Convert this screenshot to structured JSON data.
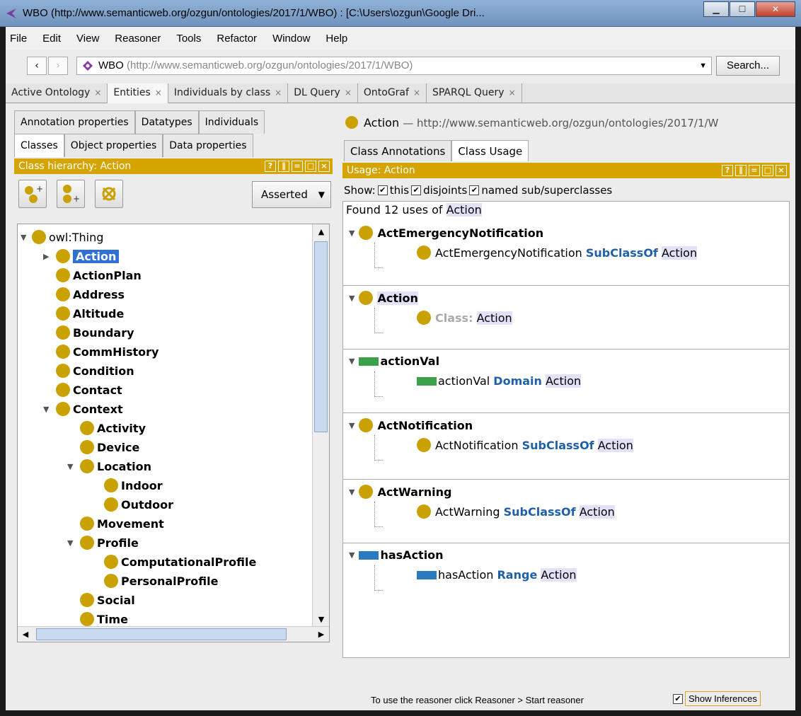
{
  "window": {
    "title": "WBO (http://www.semanticweb.org/ozgun/ontologies/2017/1/WBO)  : [C:\\Users\\ozgun\\Google Dri..."
  },
  "menu": [
    "File",
    "Edit",
    "View",
    "Reasoner",
    "Tools",
    "Refactor",
    "Window",
    "Help"
  ],
  "address": {
    "name": "WBO",
    "uri": "(http://www.semanticweb.org/ozgun/ontologies/2017/1/WBO)",
    "search_label": "Search..."
  },
  "tabs": [
    "Active Ontology",
    "Entities",
    "Individuals by class",
    "DL Query",
    "OntoGraf",
    "SPARQL Query"
  ],
  "left": {
    "subtabs_row1": [
      "Annotation properties",
      "Datatypes",
      "Individuals"
    ],
    "subtabs_row2": [
      "Classes",
      "Object properties",
      "Data properties"
    ],
    "view_title": "Class hierarchy: Action",
    "asserted_label": "Asserted",
    "tree": [
      "owl:Thing",
      "Action",
      "ActionPlan",
      "Address",
      "Altitude",
      "Boundary",
      "CommHistory",
      "Condition",
      "Contact",
      "Context",
      "Activity",
      "Device",
      "Location",
      "Indoor",
      "Outdoor",
      "Movement",
      "Profile",
      "ComputationalProfile",
      "PersonalProfile",
      "Social",
      "Time"
    ]
  },
  "right": {
    "entity_name": "Action",
    "entity_uri": "— http://www.semanticweb.org/ozgun/ontologies/2017/1/W",
    "tabs": [
      "Class Annotations",
      "Class Usage"
    ],
    "view_title": "Usage: Action",
    "show": {
      "label": "Show:",
      "this": "this",
      "disjoints": "disjoints",
      "named": "named sub/superclasses"
    },
    "found_prefix": "Found 12 uses of",
    "found_entity": "Action",
    "usages": [
      {
        "head": "ActEmergencyNotification",
        "subject": "ActEmergencyNotification",
        "keyword": "SubClassOf",
        "object": "Action",
        "color": "#c9a100"
      },
      {
        "head": "Action",
        "subject": "",
        "keyword": "Class:",
        "object": "Action",
        "color": "#c9a100"
      },
      {
        "head": "actionVal",
        "subject": "actionVal",
        "keyword": "Domain",
        "object": "Action",
        "color": "#3aa14a"
      },
      {
        "head": "ActNotification",
        "subject": "ActNotification",
        "keyword": "SubClassOf",
        "object": "Action",
        "color": "#c9a100"
      },
      {
        "head": "ActWarning",
        "subject": "ActWarning",
        "keyword": "SubClassOf",
        "object": "Action",
        "color": "#c9a100"
      },
      {
        "head": "hasAction",
        "subject": "hasAction",
        "keyword": "Range",
        "object": "Action",
        "color": "#2a7ac0"
      }
    ]
  },
  "status": {
    "message": "To use the reasoner click Reasoner > Start reasoner",
    "show_inferences": "Show Inferences"
  },
  "colors": {
    "class": "#c9a100",
    "view_header": "#d6a400",
    "selection": "#2f6fd6",
    "keyword": "#2060a8"
  }
}
